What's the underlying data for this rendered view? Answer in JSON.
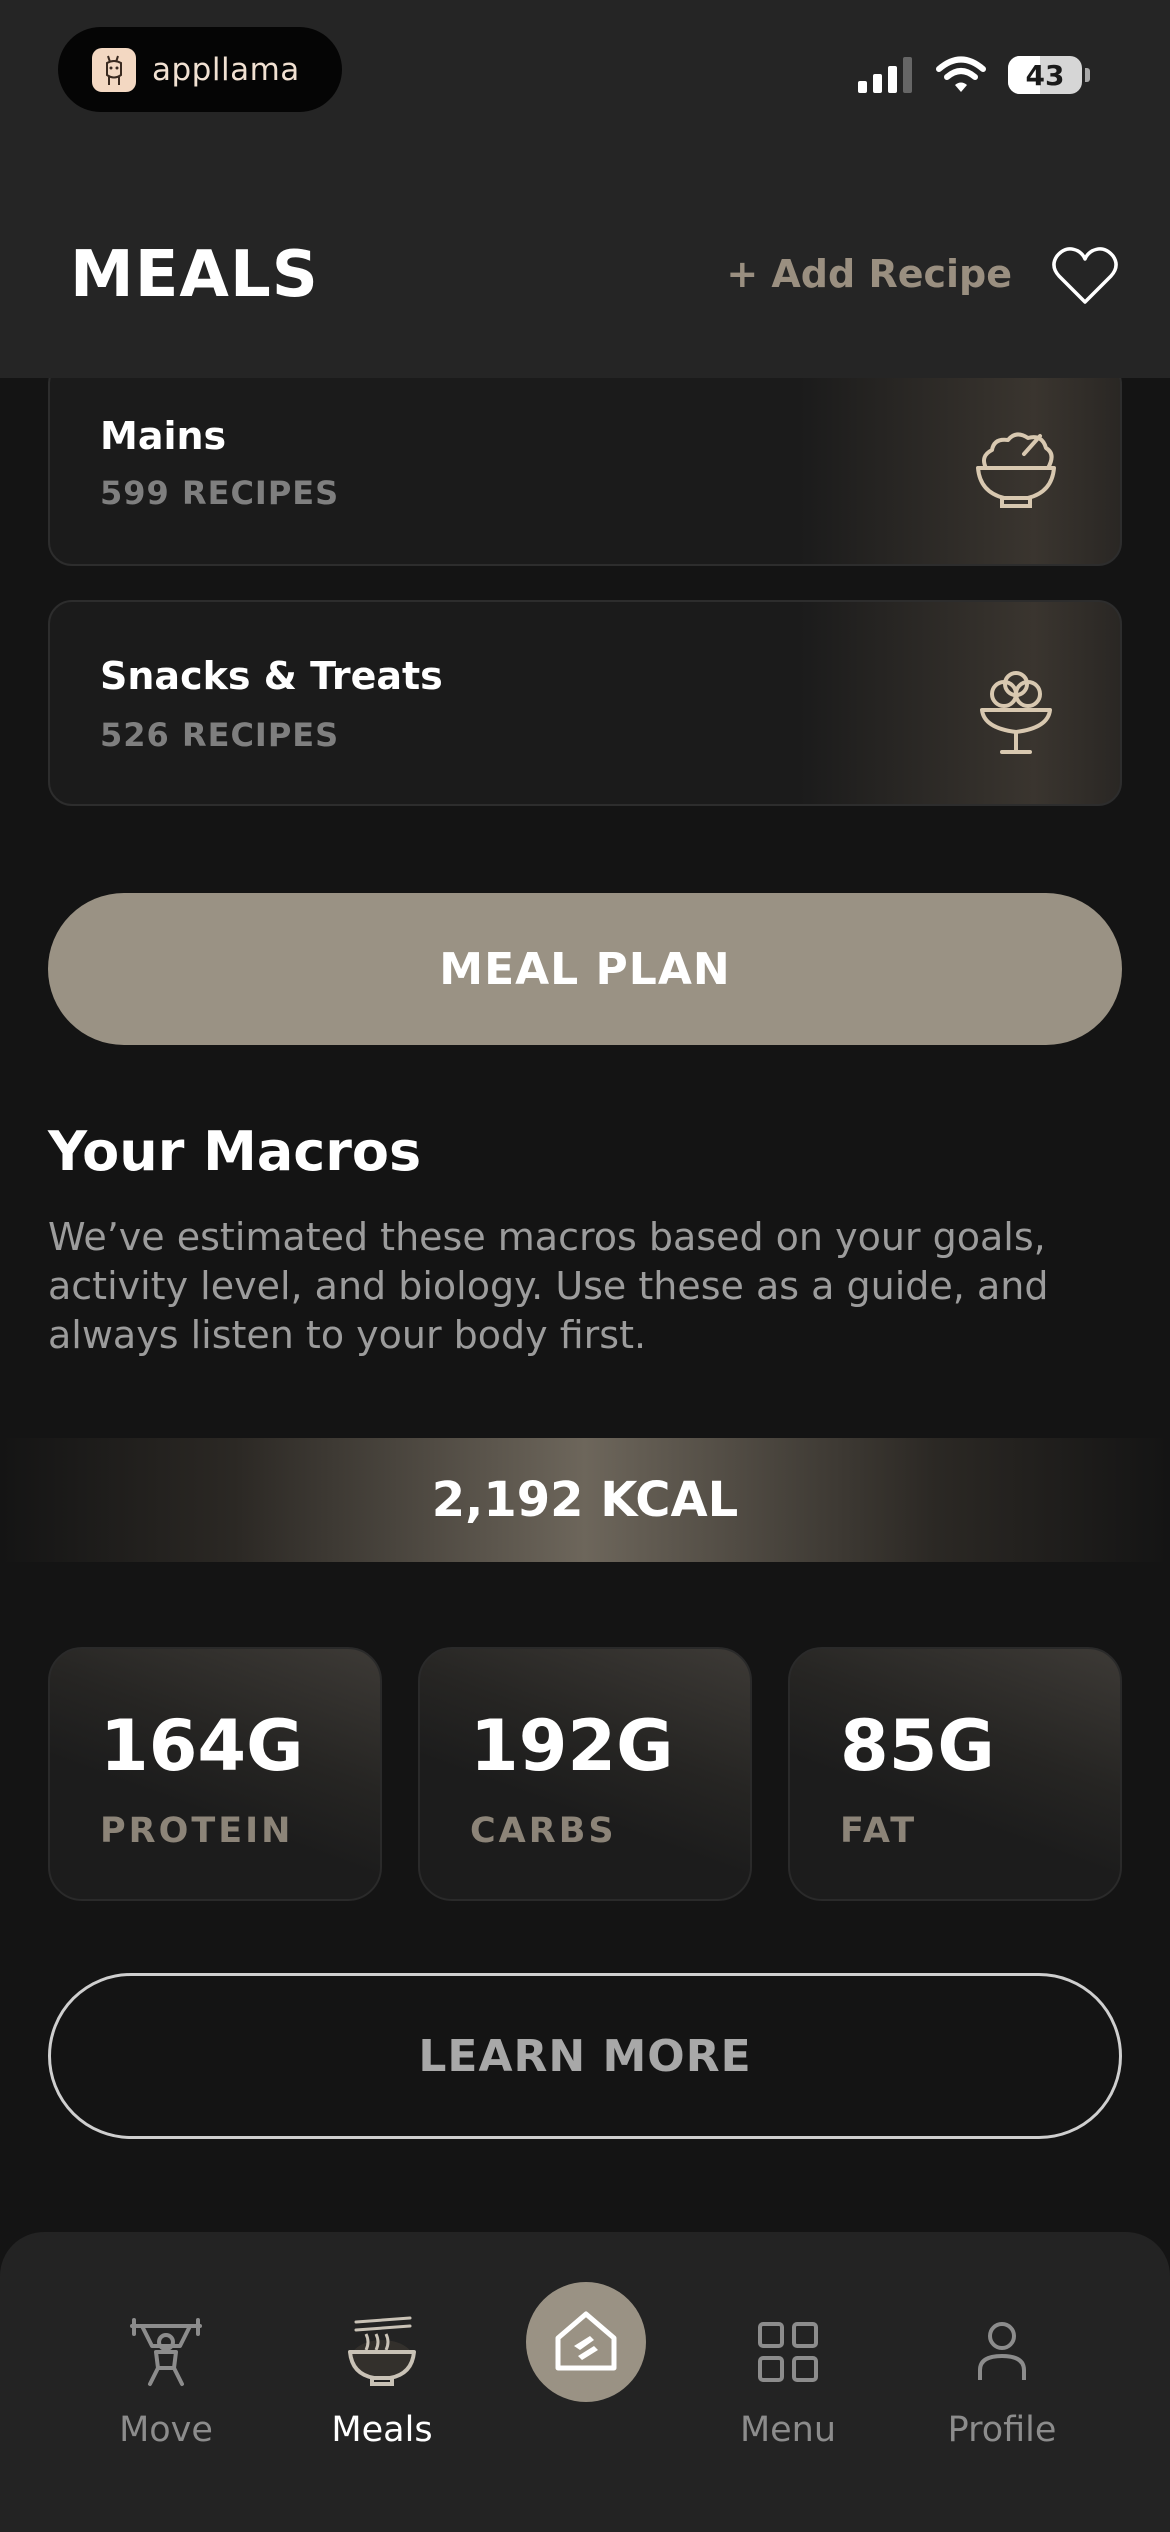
{
  "status_bar": {
    "app_name": "appllama",
    "battery": "43",
    "battery_level": 0.43
  },
  "header": {
    "title": "MEALS",
    "add_recipe_label": "+ Add Recipe"
  },
  "categories": [
    {
      "name": "Mains",
      "count": "599 RECIPES",
      "icon": "salad-bowl-icon"
    },
    {
      "name": "Snacks & Treats",
      "count": "526 RECIPES",
      "icon": "ice-cream-icon"
    }
  ],
  "meal_plan_label": "MEAL PLAN",
  "macros": {
    "heading": "Your Macros",
    "description": "We’ve estimated these macros based on your goals, activity level, and biology. Use these as a guide, and always listen to your body first.",
    "kcal": "2,192 KCAL",
    "items": [
      {
        "value": "164G",
        "label": "PROTEIN"
      },
      {
        "value": "192G",
        "label": "CARBS"
      },
      {
        "value": "85G",
        "label": "FAT"
      }
    ],
    "learn_more_label": "LEARN MORE"
  },
  "tabbar": {
    "items": [
      {
        "label": "Move",
        "icon": "weightlifter-icon",
        "active": false
      },
      {
        "label": "Meals",
        "icon": "noodle-bowl-icon",
        "active": true
      },
      {
        "label": "",
        "icon": "home-logo-icon",
        "active": false
      },
      {
        "label": "Menu",
        "icon": "grid-icon",
        "active": false
      },
      {
        "label": "Profile",
        "icon": "person-icon",
        "active": false
      }
    ]
  },
  "colors": {
    "accent": "#9a9284",
    "background": "#141414",
    "header_bg": "#252525",
    "muted_text": "#9c9c9c"
  }
}
